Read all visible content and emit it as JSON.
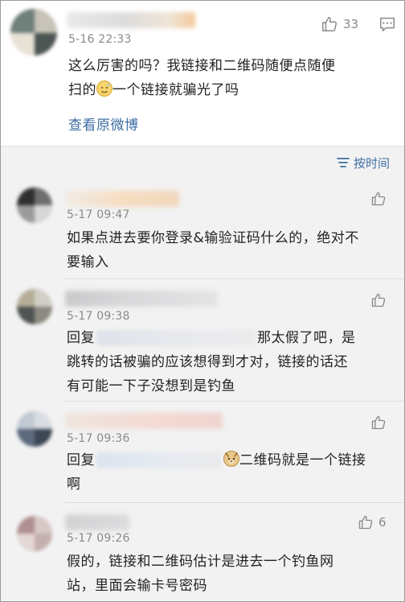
{
  "post": {
    "timestamp": "5-16 22:33",
    "like_count": "33",
    "text_line1": "这么厉害的吗？我链接和二维码随便点随便",
    "text_line2_before": "扫的",
    "text_line2_after": "一个链接就骗光了吗",
    "view_original": "查看原微博"
  },
  "sort": {
    "label": "按时间"
  },
  "comments": [
    {
      "timestamp": "5-17 09:47",
      "line1": "如果点进去要你登录&输验证码什么的，绝对不",
      "line2": "要输入",
      "like_count": ""
    },
    {
      "timestamp": "5-17 09:38",
      "reply_prefix": "回复",
      "line1_after": "那太假了吧，是",
      "line2": "跳转的话被骗的应该想得到才对，链接的话还",
      "line3": "有可能一下子没想到是钓鱼",
      "like_count": ""
    },
    {
      "timestamp": "5-17 09:36",
      "reply_prefix": "回复",
      "line1_after": "二维码就是一个链接",
      "line2": "啊",
      "like_count": ""
    },
    {
      "timestamp": "5-17 09:26",
      "line1": "假的，链接和二维码估计是进去一个钓鱼网",
      "line2": "站，里面会输卡号密码",
      "like_count": "6"
    }
  ],
  "icons": {
    "like": "thumbs-up-icon",
    "comment": "comment-icon",
    "sort": "sort-lines-icon",
    "emoji_sweat": "sweat-smile-emoji",
    "emoji_doge": "doge-emoji"
  },
  "colors": {
    "link_blue": "#3f6ea3",
    "meta_gray": "#8a8a8a",
    "band_bg": "#f2f2f2"
  }
}
